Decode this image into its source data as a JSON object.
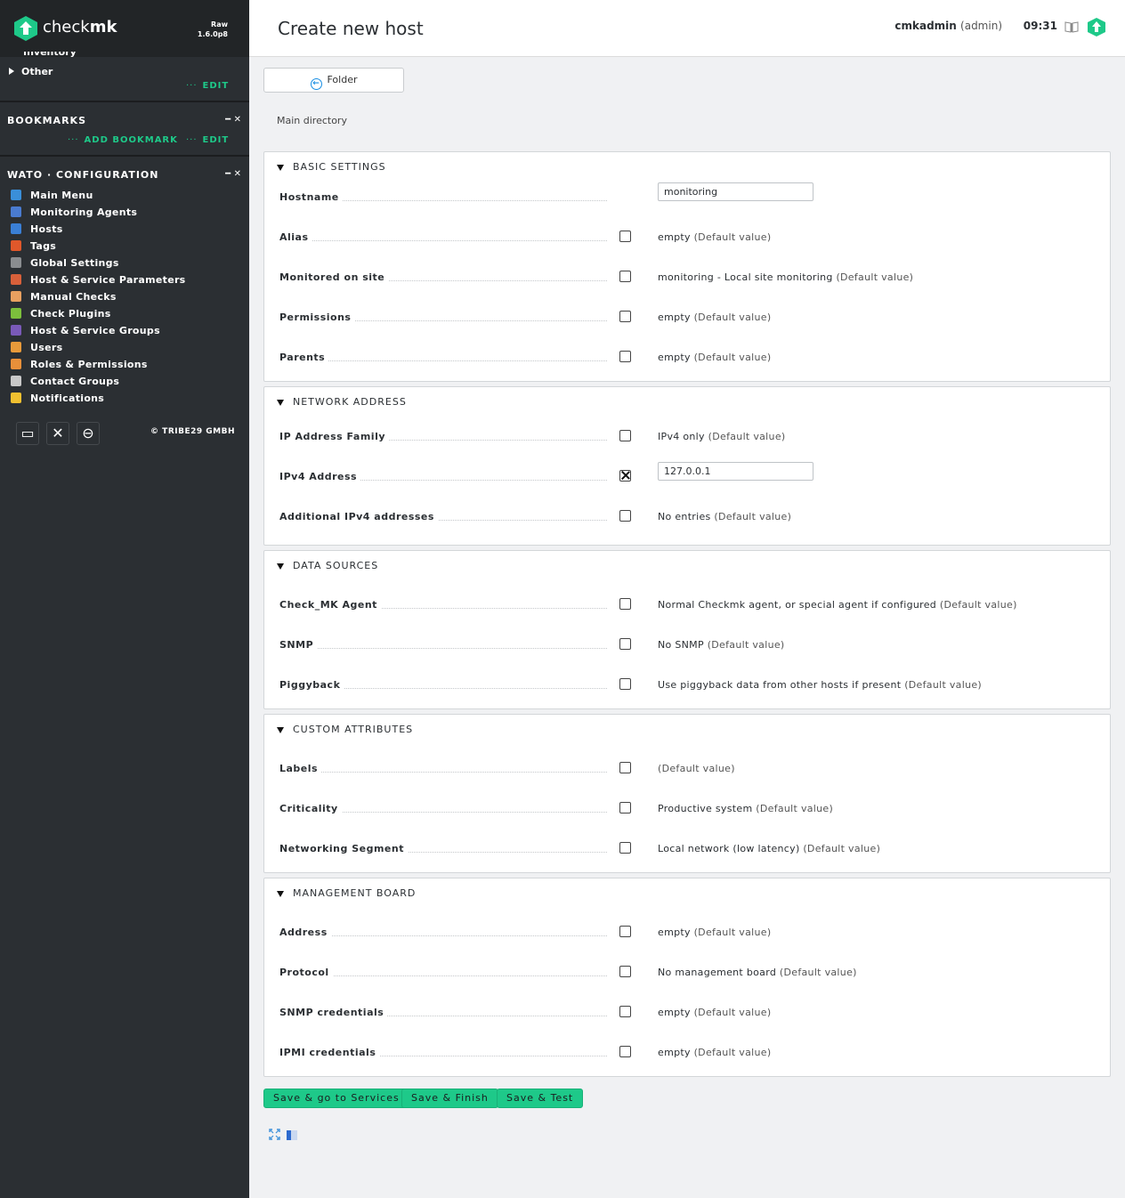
{
  "app": {
    "logo_text_regular": "check",
    "logo_text_bold": "mk",
    "edition": "Raw",
    "version": "1.6.0p8",
    "brand_color": "#1ec989"
  },
  "sidebar": {
    "tree": {
      "partial_item": "Inventory",
      "item_other": "Other",
      "edit": "EDIT"
    },
    "bookmarks": {
      "title": "BOOKMARKS",
      "add": "ADD BOOKMARK",
      "edit": "EDIT"
    },
    "wato": {
      "title": "WATO · CONFIGURATION",
      "items": [
        {
          "label": "Main Menu",
          "icon": "home-icon",
          "color": "#3a8fd9"
        },
        {
          "label": "Monitoring Agents",
          "icon": "agent-icon",
          "color": "#4a7bd0"
        },
        {
          "label": "Hosts",
          "icon": "server-icon",
          "color": "#3a7fd5"
        },
        {
          "label": "Tags",
          "icon": "tag-icon",
          "color": "#e0582b"
        },
        {
          "label": "Global Settings",
          "icon": "gear-icon",
          "color": "#8a8d90"
        },
        {
          "label": "Host & Service Parameters",
          "icon": "rules-icon",
          "color": "#d8603a"
        },
        {
          "label": "Manual Checks",
          "icon": "hand-icon",
          "color": "#e8a060"
        },
        {
          "label": "Check Plugins",
          "icon": "plugin-icon",
          "color": "#7cbf3c"
        },
        {
          "label": "Host & Service Groups",
          "icon": "groups-icon",
          "color": "#7a5ab8"
        },
        {
          "label": "Users",
          "icon": "users-icon",
          "color": "#e89a3a"
        },
        {
          "label": "Roles & Permissions",
          "icon": "roles-icon",
          "color": "#e8903a"
        },
        {
          "label": "Contact Groups",
          "icon": "contact-groups-icon",
          "color": "#c8c8c8"
        },
        {
          "label": "Notifications",
          "icon": "bell-icon",
          "color": "#f0c030"
        }
      ]
    },
    "copyright": "© TRIBE29 GMBH"
  },
  "header": {
    "title": "Create new host",
    "user": "cmkadmin",
    "role": "(admin)",
    "time": "09:31"
  },
  "toolbar": {
    "folder_label": "Folder"
  },
  "breadcrumb": "Main directory",
  "default_suffix": "(Default value)",
  "sections": {
    "basic": {
      "title": "BASIC SETTINGS",
      "hostname_label": "Hostname",
      "hostname_value": "monitoring",
      "rows": [
        {
          "label": "Alias",
          "value": "empty"
        },
        {
          "label": "Monitored on site",
          "value": "monitoring - Local site monitoring"
        },
        {
          "label": "Permissions",
          "value": "empty"
        },
        {
          "label": "Parents",
          "value": "empty"
        }
      ]
    },
    "network": {
      "title": "NETWORK ADDRESS",
      "ip_family_label": "IP Address Family",
      "ip_family_value": "IPv4 only",
      "ipv4_label": "IPv4 Address",
      "ipv4_value": "127.0.0.1",
      "ipv4_checked": true,
      "additional_label": "Additional IPv4 addresses",
      "additional_value": "No entries"
    },
    "datasources": {
      "title": "DATA SOURCES",
      "rows": [
        {
          "label": "Check_MK Agent",
          "value": "Normal Checkmk agent, or special agent if configured"
        },
        {
          "label": "SNMP",
          "value": "No SNMP"
        },
        {
          "label": "Piggyback",
          "value": "Use piggyback data from other hosts if present"
        }
      ]
    },
    "custom": {
      "title": "CUSTOM ATTRIBUTES",
      "rows": [
        {
          "label": "Labels",
          "value": ""
        },
        {
          "label": "Criticality",
          "value": "Productive system"
        },
        {
          "label": "Networking Segment",
          "value": "Local network (low latency)"
        }
      ]
    },
    "management": {
      "title": "MANAGEMENT BOARD",
      "rows": [
        {
          "label": "Address",
          "value": "empty"
        },
        {
          "label": "Protocol",
          "value": "No management board"
        },
        {
          "label": "SNMP credentials",
          "value": "empty"
        },
        {
          "label": "IPMI credentials",
          "value": "empty"
        }
      ]
    }
  },
  "actions": {
    "save_services": "Save & go to Services",
    "save_finish": "Save & Finish",
    "save_test": "Save & Test"
  }
}
